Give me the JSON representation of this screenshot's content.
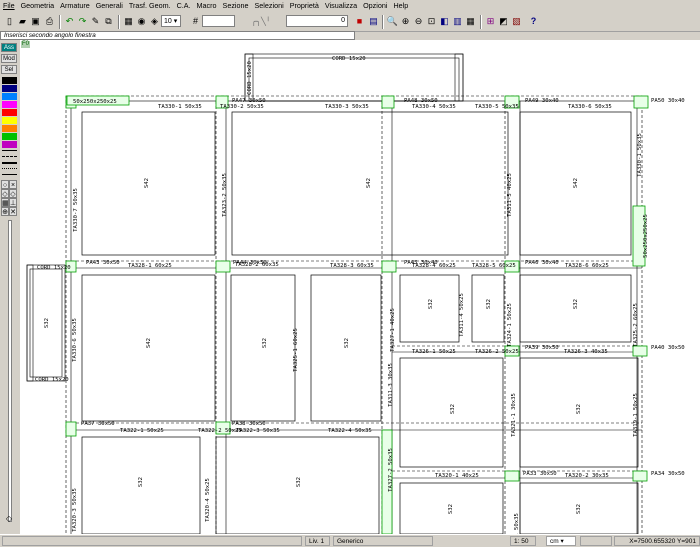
{
  "menu": [
    "File",
    "Geometria",
    "Armature",
    "Generali",
    "Trasf. Geom.",
    "C.A.",
    "Macro",
    "Sezione",
    "Selezioni",
    "Proprietà",
    "Visualizza",
    "Opzioni",
    "Help"
  ],
  "toolbar": {
    "layer_value": "10",
    "field_value": "0"
  },
  "prompt": "Inserisci secondo angolo finestra",
  "palette": {
    "ass": "Ass",
    "mod": "Mod",
    "sel": "Sel",
    "colors": [
      "#000000",
      "#000080",
      "#ff00ff",
      "#ff0000",
      "#ffff00",
      "#ff8000",
      "#00ff00",
      "#ff00ff"
    ]
  },
  "canvas_tag": "F0",
  "drawing": {
    "slabs": [
      "S42",
      "S42",
      "S42",
      "S42",
      "S32",
      "S32",
      "S32",
      "S32",
      "S32",
      "S32",
      "S32",
      "S32",
      "S32",
      "S32",
      "S32",
      "S32"
    ],
    "beams": [
      "TA330-1 50x35",
      "TA330-2 50x35",
      "TA330-3 50x35",
      "TA330-4 50x35",
      "TA330-5 50x35",
      "TA330-6 50x35",
      "TA328-1 60x25",
      "TA328-2 60x35",
      "TA328-3 60x35",
      "TA328-4 60x25",
      "TA328-5 60x25",
      "TA328-6 60x25",
      "TA326-1 50x25",
      "TA326-2 50x25",
      "TA326-3 40x35",
      "TA322-1 50x25",
      "TA322-2 50x25",
      "TA322-3 50x35",
      "TA322-4 50x35",
      "TA320-1 40x25",
      "TA320-2 30x35",
      "TA330-7 50x35",
      "TA323-2 50x35",
      "TA311-5 40x25",
      "TA330-1 50x35",
      "TA330-6 50x35",
      "TA325-2 60x25",
      "TA327-1 40x25",
      "TA311-4 50x25",
      "TA324-1 50x25",
      "TA325-1 60x25",
      "TA311-3 30x35",
      "TA321-1 30x35",
      "TA319-1 50x25",
      "TA320-4 50x25",
      "TA320-3 50x35",
      "TA327-2 50x35",
      "TA323-1 50x35"
    ],
    "columns": [
      "PA47 30x50",
      "PA48 30x50",
      "PA49 30x40",
      "PA50 30x40",
      "PA43 30x50",
      "PA44 30x50",
      "PA45 30x40",
      "PA46 30x40",
      "PA39 30x50",
      "PA40 30x50",
      "PA37 30x50",
      "PA38 30x50",
      "PA33 30x50",
      "PA34 30x50"
    ],
    "corbels": [
      "CORD 15x20",
      "CORD 15x20",
      "CORD 15x20",
      "CORD 15x20",
      "50x250x250x25",
      "50x250x250x25"
    ]
  },
  "status": {
    "level": "Liv.  1",
    "mode": "Generico",
    "scale": "1: 50",
    "unit": "cm",
    "coords": "X=7500.655320 Y=901"
  }
}
